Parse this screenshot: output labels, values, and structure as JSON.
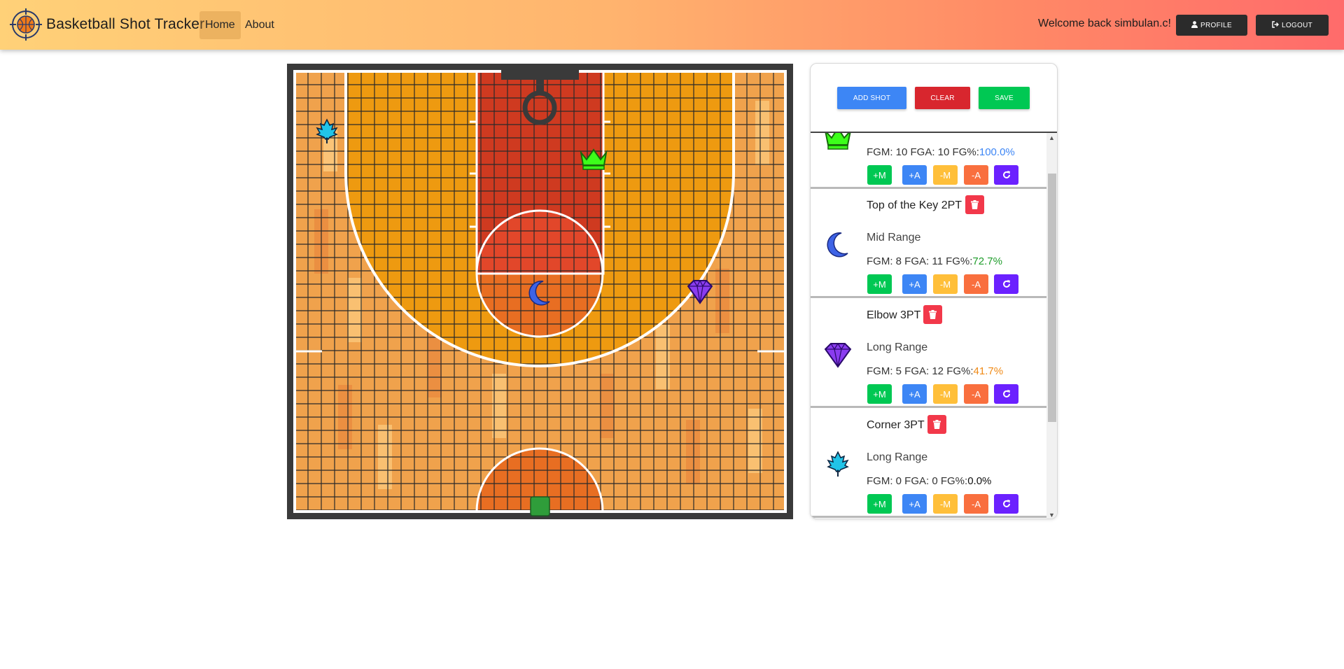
{
  "app": {
    "title": "Basketball Shot Tracker"
  },
  "nav": {
    "home": "Home",
    "about": "About"
  },
  "user": {
    "welcome": "Welcome back simbulan.c!"
  },
  "header_buttons": {
    "profile": "PROFILE",
    "logout": "LOGOUT"
  },
  "actions": {
    "add_shot": "ADD SHOT",
    "clear": "CLEAR",
    "save": "SAVE"
  },
  "colors": {
    "fg_blue": "#3d86f5",
    "fg_green": "#1f9d2b",
    "fg_orange": "#f08a16",
    "fg_black": "#111111"
  },
  "shots": [
    {
      "title": "",
      "icon": "crown-icon",
      "range": "",
      "stats": "FGM: 10 FGA: 10 FG%:",
      "fg_pct": "100.0%",
      "fg_color": "#3d86f5"
    },
    {
      "title": "Top of the Key 2PT",
      "icon": "moon-icon",
      "range": "Mid Range",
      "stats": "FGM: 8 FGA: 11 FG%:",
      "fg_pct": "72.7%",
      "fg_color": "#1f9d2b"
    },
    {
      "title": "Elbow 3PT",
      "icon": "diamond-icon",
      "range": "Long Range",
      "stats": "FGM: 5 FGA: 12 FG%:",
      "fg_pct": "41.7%",
      "fg_color": "#f08a16"
    },
    {
      "title": "Corner 3PT",
      "icon": "maple-leaf-icon",
      "range": "Long Range",
      "stats": "FGM: 0 FGA: 0 FG%:",
      "fg_pct": "0.0%",
      "fg_color": "#111111"
    }
  ],
  "shot_buttons": {
    "plus_make": "+M",
    "plus_attempt": "+A",
    "minus_make": "-M",
    "minus_attempt": "-A"
  }
}
